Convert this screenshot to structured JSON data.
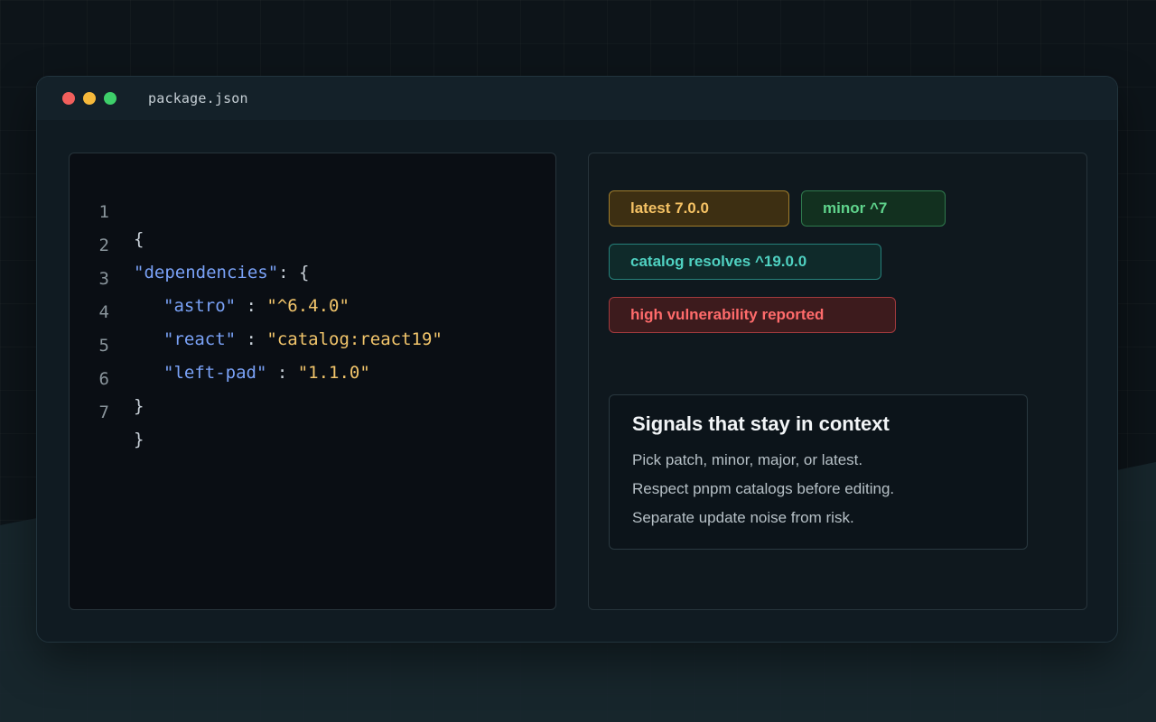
{
  "window": {
    "filename": "package.json"
  },
  "editor": {
    "lines": [
      {
        "number": "1",
        "text": "{"
      },
      {
        "number": "2",
        "key": "\"dependencies\"",
        "punc": ": {"
      },
      {
        "number": "3",
        "key": "\"astro\"",
        "sep": " : ",
        "value": "\"^6.4.0\""
      },
      {
        "number": "4",
        "key": "\"react\"",
        "sep": " : ",
        "value": "\"catalog:react19\""
      },
      {
        "number": "5",
        "key": "\"left-pad\"",
        "sep": " : ",
        "value": "\"1.1.0\""
      },
      {
        "number": "6",
        "text": "}"
      },
      {
        "number": "7",
        "text": "}"
      }
    ]
  },
  "badges": {
    "latest": "latest 7.0.0",
    "minor": "minor ^7",
    "catalog": "catalog resolves ^19.0.0",
    "vulnerability": "high vulnerability reported"
  },
  "info_card": {
    "title": "Signals that stay in context",
    "lines": [
      "Pick patch, minor, major, or latest.",
      "Respect pnpm catalogs before editing.",
      "Separate update noise from risk."
    ]
  },
  "colors": {
    "key": "#7aa2f7",
    "string": "#f2c56b",
    "latest_badge": "#f5c264",
    "minor_badge": "#5fd38c",
    "catalog_badge": "#4fd1c1",
    "vulnerability_badge": "#ff6b6b"
  }
}
